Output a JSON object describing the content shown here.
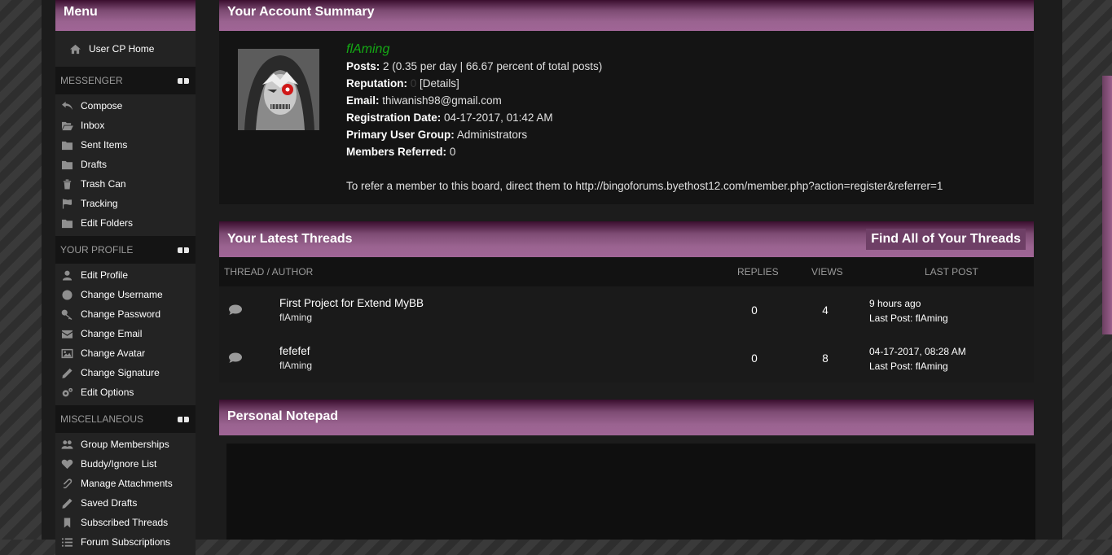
{
  "sidebar": {
    "title": "Menu",
    "home": {
      "icon": "home-icon",
      "label": "User CP Home"
    },
    "sections": [
      {
        "title": "Messenger",
        "items": [
          {
            "icon": "reply-icon",
            "label": "Compose"
          },
          {
            "icon": "inbox-icon",
            "label": "Inbox"
          },
          {
            "icon": "folder-icon",
            "label": "Sent Items"
          },
          {
            "icon": "folder-icon",
            "label": "Drafts"
          },
          {
            "icon": "trash-icon",
            "label": "Trash Can"
          },
          {
            "icon": "flag-icon",
            "label": "Tracking"
          },
          {
            "icon": "folder-icon",
            "label": "Edit Folders"
          }
        ]
      },
      {
        "title": "Your Profile",
        "items": [
          {
            "icon": "user-icon",
            "label": "Edit Profile"
          },
          {
            "icon": "circle-icon",
            "label": "Change Username"
          },
          {
            "icon": "key-icon",
            "label": "Change Password"
          },
          {
            "icon": "envelope-icon",
            "label": "Change Email"
          },
          {
            "icon": "picture-icon",
            "label": "Change Avatar"
          },
          {
            "icon": "pencil-icon",
            "label": "Change Signature"
          },
          {
            "icon": "gears-icon",
            "label": "Edit Options"
          }
        ]
      },
      {
        "title": "Miscellaneous",
        "items": [
          {
            "icon": "group-icon",
            "label": "Group Memberships"
          },
          {
            "icon": "heart-icon",
            "label": "Buddy/Ignore List"
          },
          {
            "icon": "paperclip-icon",
            "label": "Manage Attachments"
          },
          {
            "icon": "pencil-icon",
            "label": "Saved Drafts"
          },
          {
            "icon": "bookmark-icon",
            "label": "Subscribed Threads"
          },
          {
            "icon": "list-icon",
            "label": "Forum Subscriptions"
          }
        ]
      }
    ]
  },
  "summary": {
    "title": "Your Account Summary",
    "username": "flAming",
    "posts_label": "Posts:",
    "posts_value": "2 (0.35 per day | 66.67 percent of total posts)",
    "reputation_label": "Reputation:",
    "reputation_value": "0",
    "reputation_details": "[Details]",
    "email_label": "Email:",
    "email_value": "thiwanish98@gmail.com",
    "registration_label": "Registration Date:",
    "registration_value": "04-17-2017, 01:42 AM",
    "group_label": "Primary User Group:",
    "group_value": "Administrators",
    "referred_label": "Members Referred:",
    "referred_value": "0",
    "refer_text": "To refer a member to this board, direct them to http://bingoforums.byethost12.com/member.php?action=register&referrer=1"
  },
  "threads": {
    "title": "Your Latest Threads",
    "find_all": "Find All of Your Threads",
    "columns": {
      "thread": "Thread / Author",
      "replies": "Replies",
      "views": "Views",
      "last_post": "Last Post"
    },
    "rows": [
      {
        "subject": "First Project for Extend MyBB",
        "author": "flAming",
        "replies": "0",
        "views": "4",
        "last_time": "9 hours ago",
        "last_by": "Last Post: flAming"
      },
      {
        "subject": "fefefef",
        "author": "flAming",
        "replies": "0",
        "views": "8",
        "last_time": "04-17-2017, 08:28 AM",
        "last_by": "Last Post: flAming"
      }
    ]
  },
  "notepad": {
    "title": "Personal Notepad"
  }
}
